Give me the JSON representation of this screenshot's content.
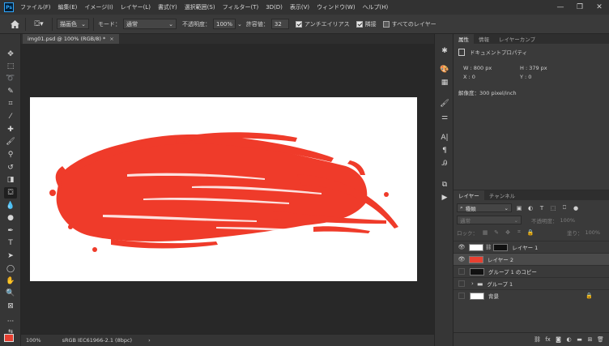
{
  "menubar": {
    "logo": "Ps",
    "items": [
      "ファイル(F)",
      "編集(E)",
      "イメージ(I)",
      "レイヤー(L)",
      "書式(Y)",
      "選択範囲(S)",
      "フィルター(T)",
      "3D(D)",
      "表示(V)",
      "ウィンドウ(W)",
      "ヘルプ(H)"
    ],
    "window_controls": [
      "—",
      "❐",
      "✕"
    ]
  },
  "options": {
    "fill_source": "描画色",
    "mode_label": "モード：",
    "mode_value": "通常",
    "opacity_label": "不透明度：",
    "opacity_value": "100%",
    "tolerance_label": "許容値：",
    "tolerance_value": "32",
    "antialias_label": "アンチエイリアス",
    "contiguous_label": "隣接",
    "all_layers_label": "すべてのレイヤー"
  },
  "document": {
    "tab_title": "img01.psd @ 100% (RGB/8) *",
    "close": "×"
  },
  "status": {
    "zoom": "100%",
    "profile": "sRGB IEC61966-2.1 (8bpc)",
    "arrow": "›"
  },
  "properties": {
    "tabs": [
      "属性",
      "情報",
      "レイヤーカンプ"
    ],
    "title": "ドキュメントプロパティ",
    "w": "W :  800 px",
    "h": "H :  379 px",
    "x": "X :  0",
    "y": "Y :  0",
    "resolution": "解像度：300 pixel/inch"
  },
  "layers": {
    "tabs": [
      "レイヤー",
      "チャンネル"
    ],
    "filter_kind": "種類",
    "blend_mode": "通常",
    "opacity_label": "不透明度：",
    "opacity_value": "100%",
    "lock_label": "ロック：",
    "fill_label": "塗り：",
    "fill_value": "100%",
    "items": [
      {
        "name": "レイヤー 1",
        "visible": true,
        "thumb": "#ffffff"
      },
      {
        "name": "レイヤー 2",
        "visible": true,
        "thumb": "#e84031"
      },
      {
        "name": "グループ 1 のコピー",
        "visible": false,
        "thumb": "#ffffff"
      },
      {
        "name": "グループ 1",
        "visible": false,
        "thumb": "folder"
      },
      {
        "name": "背景",
        "visible": false,
        "thumb": "#ffffff"
      }
    ]
  },
  "colors": {
    "foreground": "#e84031",
    "paint": "#ef3b2a"
  }
}
